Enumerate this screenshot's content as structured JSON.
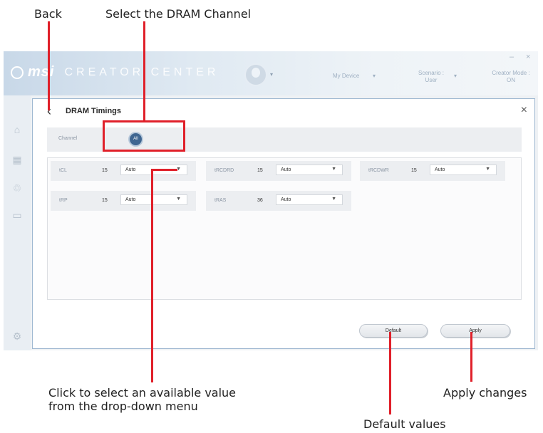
{
  "callouts": {
    "back": "Back",
    "select_channel": "Select the DRAM Channel",
    "dropdown_line1": "Click to select an available value",
    "dropdown_line2": "from the drop-down menu",
    "apply_changes": "Apply changes",
    "default_values": "Default values"
  },
  "header": {
    "brand": "msi",
    "product": "CREATOR CENTER",
    "my_device": "My Device",
    "scenario_label": "Scenario :",
    "scenario_value": "User",
    "creator_mode_label": "Creator Mode :",
    "creator_mode_value": "ON",
    "minimize": "–",
    "close": "×"
  },
  "panel": {
    "title": "DRAM Timings",
    "back_glyph": "‹",
    "close_glyph": "×",
    "channel_label": "Channel",
    "channel_value": "All"
  },
  "timings": [
    {
      "name": "tCL",
      "value": "15",
      "mode": "Auto"
    },
    {
      "name": "tRCDRD",
      "value": "15",
      "mode": "Auto"
    },
    {
      "name": "tRCDWR",
      "value": "15",
      "mode": "Auto"
    },
    {
      "name": "tRP",
      "value": "15",
      "mode": "Auto"
    },
    {
      "name": "tRAS",
      "value": "36",
      "mode": "Auto"
    }
  ],
  "buttons": {
    "default": "Default",
    "apply": "Apply"
  },
  "icons": {
    "sidebar": [
      "home-icon",
      "grid-icon",
      "recycle-icon",
      "toolbox-icon",
      "gear-icon"
    ]
  },
  "colors": {
    "accent": "#3f6691",
    "callout_red": "#e0202a"
  }
}
